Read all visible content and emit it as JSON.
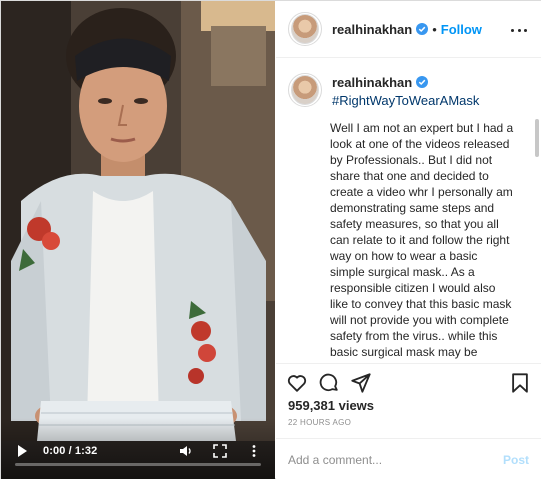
{
  "video": {
    "time_display": "0:00 / 1:32",
    "progress": 0,
    "icons": [
      "play-icon",
      "volume-icon",
      "fullscreen-icon",
      "more-vertical-icon"
    ]
  },
  "header": {
    "username": "realhinakhan",
    "separator": "•",
    "follow_label": "Follow",
    "icons": [
      "verified-icon",
      "more-options-icon"
    ]
  },
  "caption": {
    "username": "realhinakhan",
    "hashtag": "#RightWayToWearAMask",
    "body": "Well I am not an expert but I had a look at one of the videos released by Professionals.. But I did not share that one and decided to create a video whr I personally am demonstrating same steps and safety measures, so that you all can relate to it and follow the right way on how to wear a basic simple surgical mask.. As a responsible citizen I would also like to convey that this basic mask will not provide you with complete safety from the virus.. while this basic surgical mask may be effective in blocking splashes and large particle droplets but it does not filter or block"
  },
  "actions": {
    "icons": [
      "heart-icon",
      "comment-icon",
      "share-icon",
      "bookmark-icon"
    ]
  },
  "stats": {
    "views": "959,381 views",
    "time_ago": "22 HOURS AGO"
  },
  "comment": {
    "placeholder": "Add a comment...",
    "post_label": "Post"
  },
  "colors": {
    "link_blue": "#0095f6",
    "hashtag_blue": "#00376b",
    "post_disabled": "#b2dffc",
    "muted": "#8e8e8e",
    "text": "#262626"
  }
}
